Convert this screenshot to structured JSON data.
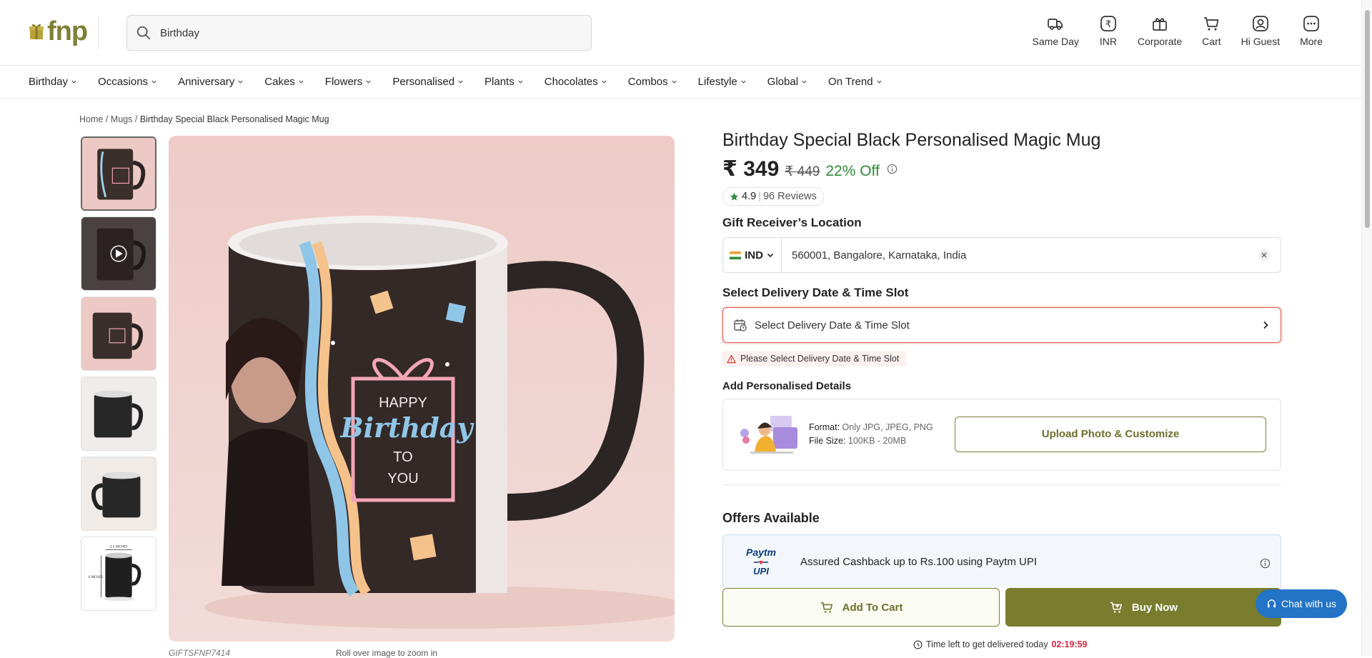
{
  "header": {
    "logo_text": "fnp",
    "search_value": "Birthday",
    "actions": [
      {
        "label": "Same Day",
        "icon": "truck-icon"
      },
      {
        "label": "INR",
        "icon": "currency-icon"
      },
      {
        "label": "Corporate",
        "icon": "gift-icon"
      },
      {
        "label": "Cart",
        "icon": "cart-icon"
      },
      {
        "label": "Hi Guest",
        "icon": "user-icon"
      },
      {
        "label": "More",
        "icon": "more-icon"
      }
    ]
  },
  "nav": {
    "items": [
      "Birthday",
      "Occasions",
      "Anniversary",
      "Cakes",
      "Flowers",
      "Personalised",
      "Plants",
      "Chocolates",
      "Combos",
      "Lifestyle",
      "Global",
      "On Trend"
    ]
  },
  "breadcrumb": {
    "home": "Home",
    "sep1": "/",
    "cat": "Mugs",
    "sep2": "/",
    "current": "Birthday Special Black Personalised Magic Mug"
  },
  "gallery": {
    "sku": "GIFTSFNP7414",
    "zoom_hint": "Roll over image to zoom in",
    "mug_text": {
      "line1": "HAPPY",
      "line2": "Birthday",
      "line3": "TO",
      "line4": "YOU"
    },
    "dim_label_top": "3.5 INCHES",
    "dim_label_side": "4 INCHES"
  },
  "product": {
    "title": "Birthday Special Black Personalised Magic Mug",
    "price": "₹ 349",
    "mrp": "₹ 449",
    "discount": "22% Off",
    "rating": "4.9",
    "rating_sep": "|",
    "reviews": "96 Reviews"
  },
  "location": {
    "label": "Gift Receiver’s Location",
    "country": "IND",
    "value": "560001, Bangalore, Karnataka, India"
  },
  "delivery": {
    "label": "Select Delivery Date & Time Slot",
    "placeholder": "Select Delivery Date & Time Slot",
    "warning": "Please Select Delivery Date & Time Slot"
  },
  "personalise": {
    "label": "Add Personalised Details",
    "format_key": "Format:",
    "format_val": "Only JPG, JPEG, PNG",
    "size_key": "File Size:",
    "size_val": "100KB - 20MB",
    "button": "Upload Photo & Customize"
  },
  "offers": {
    "title": "Offers Available",
    "brand_line1": "Paytm",
    "brand_line2": "UPI",
    "text": "Assured Cashback up to Rs.100 using Paytm UPI"
  },
  "cta": {
    "add_to_cart": "Add To Cart",
    "buy_now": "Buy Now",
    "timer_label": "Time left to get delivered today",
    "timer_value": "02:19:59"
  },
  "chat": {
    "label": "Chat with us"
  },
  "colors": {
    "brand": "#7e8035",
    "accent_red": "#e05a4b",
    "discount_green": "#2e8b3a",
    "chat_blue": "#2373c7"
  }
}
